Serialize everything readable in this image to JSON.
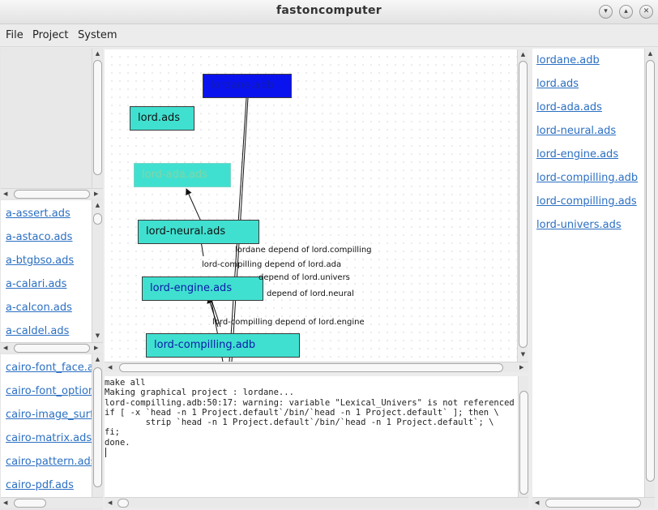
{
  "window": {
    "title": "fastoncomputer",
    "minimize_glyph": "▾",
    "maximize_glyph": "▴",
    "close_glyph": "✕"
  },
  "menu": {
    "items": [
      "File",
      "Project",
      "System"
    ]
  },
  "left_panel": {
    "list1": [
      "a-assert.ads",
      "a-astaco.ads",
      "a-btgbso.ads",
      "a-calari.ads",
      "a-calcon.ads",
      "a-caldel.ads"
    ],
    "list2": [
      "cairo-font_face.ads",
      "cairo-font_options.ads",
      "cairo-image_surface.ads",
      "cairo-matrix.ads",
      "cairo-pattern.ads",
      "cairo-pdf.ads"
    ]
  },
  "right_panel": {
    "files": [
      "lordane.adb",
      "lord.ads",
      "lord-ada.ads",
      "lord-neural.ads",
      "lord-engine.ads",
      "lord-compilling.adb",
      "lord-compilling.ads",
      "lord-univers.ads"
    ]
  },
  "graph": {
    "nodes": [
      {
        "label": "lordane.adb",
        "bg": "#0a12ee",
        "fg": "#0f1cb0"
      },
      {
        "label": "lord.ads",
        "bg": "#40e0d0",
        "fg": "#111111"
      },
      {
        "label": "lord-ada.ads",
        "bg": "#40e0d0",
        "fg": "#7fd6a8"
      },
      {
        "label": "lord-neural.ads",
        "bg": "#40e0d0",
        "fg": "#111111"
      },
      {
        "label": "lord-engine.ads",
        "bg": "#40e0d0",
        "fg": "#0c1aa8"
      },
      {
        "label": "lord-compilling.adb",
        "bg": "#40e0d0",
        "fg": "#0c1aa8"
      }
    ],
    "edge_labels": [
      "lordane depend of lord.compilling",
      "lord-compilling depend of lord.ada",
      "depend of lord.univers",
      "depend of lord.neural",
      "lord-compilling depend of lord.engine"
    ]
  },
  "console": {
    "lines": [
      "make all",
      "Making graphical project : lordane...",
      "lord-compilling.adb:50:17: warning: variable \"Lexical_Univers\" is not referenced",
      "if [ -x `head -n 1 Project.default`/bin/`head -n 1 Project.default` ]; then \\",
      "        strip `head -n 1 Project.default`/bin/`head -n 1 Project.default`; \\",
      "fi;",
      "done.",
      ""
    ]
  },
  "colors": {
    "accent_link": "#2b6fc2",
    "node_main": "#0a12ee",
    "node_dep": "#40e0d0"
  }
}
